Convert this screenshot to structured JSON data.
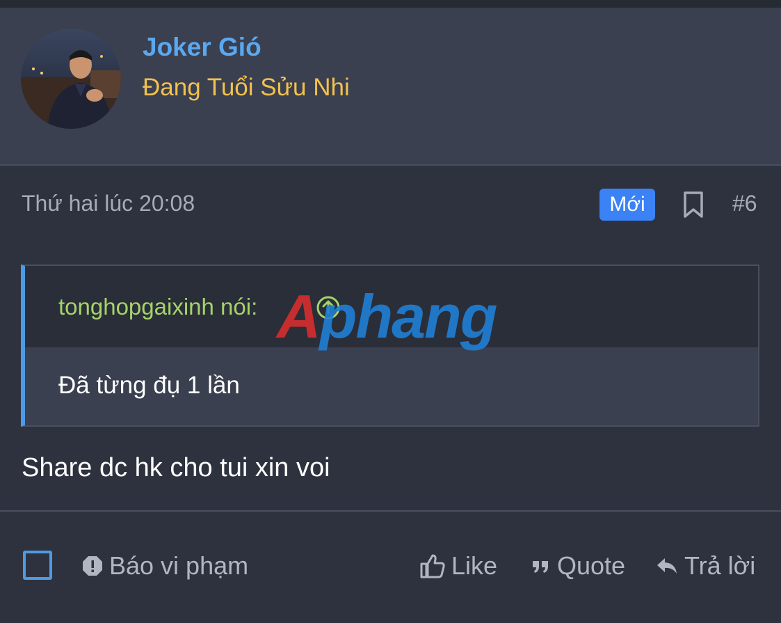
{
  "user": {
    "name": "Joker Gió",
    "title": "Đang Tuổi Sửu Nhi"
  },
  "post": {
    "time": "Thứ hai lúc 20:08",
    "badge": "Mới",
    "number": "#6",
    "quote": {
      "author": "tonghopgaixinh nói:",
      "text": "Đã từng đụ 1 lần"
    },
    "message": "Share dc hk cho tui xin voi"
  },
  "watermark": {
    "first": "A",
    "rest": "phang"
  },
  "footer": {
    "report": "Báo vi phạm",
    "like": "Like",
    "quote": "Quote",
    "reply": "Trả lời"
  },
  "colors": {
    "username": "#5aa9f0",
    "title": "#f2c14e",
    "badge": "#3b82f6",
    "quote_author": "#a6d36a",
    "accent": "#4d9be6"
  },
  "icons": [
    "bookmark-icon",
    "arrow-up-circle-icon",
    "alert-icon",
    "thumbs-up-icon",
    "quote-icon",
    "reply-icon"
  ]
}
